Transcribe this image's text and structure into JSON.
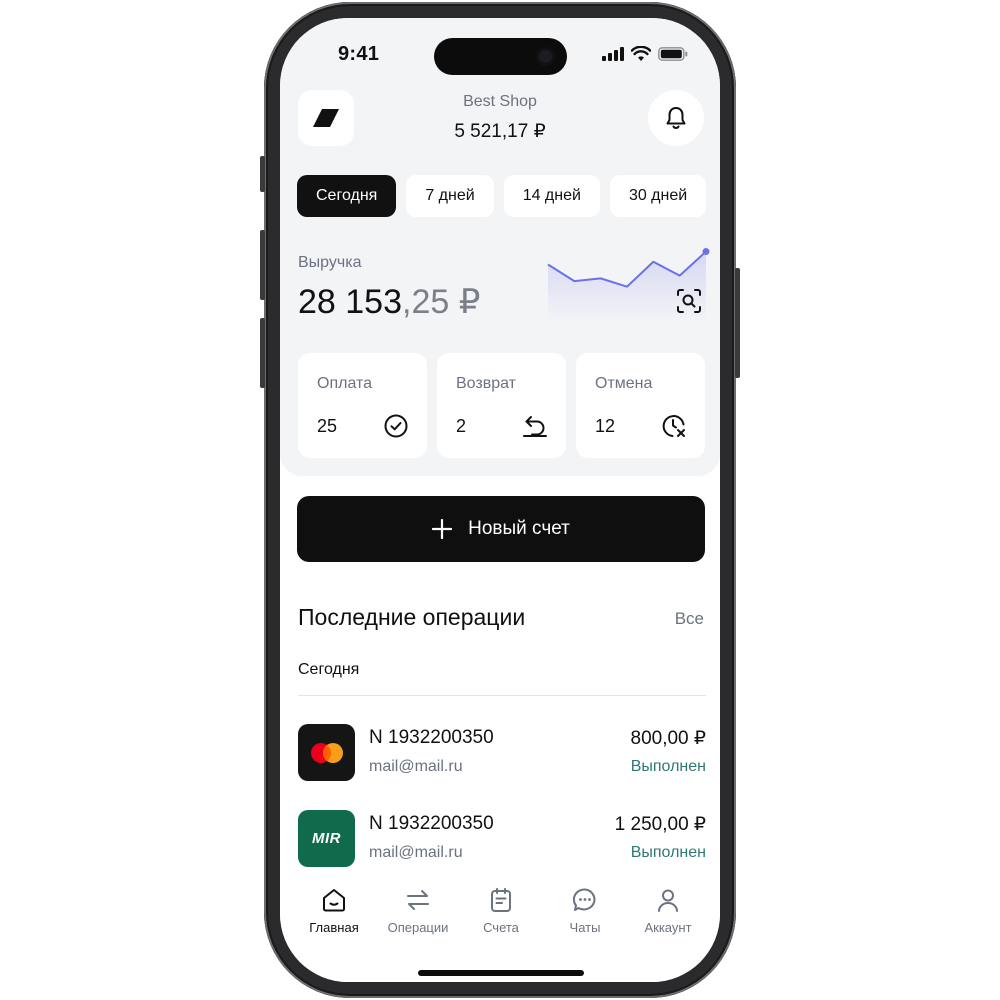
{
  "status_bar": {
    "time": "9:41"
  },
  "header": {
    "shop_name": "Best Shop",
    "balance": "5 521,17 ₽"
  },
  "period_tabs": [
    {
      "label": "Сегодня",
      "active": true
    },
    {
      "label": "7 дней",
      "active": false
    },
    {
      "label": "14 дней",
      "active": false
    },
    {
      "label": "30 дней",
      "active": false
    }
  ],
  "revenue": {
    "label": "Выручка",
    "amount_main": "28 153",
    "amount_fraction": ",25 ₽"
  },
  "revenue_sparkline": {
    "type": "line",
    "values": [
      60,
      42,
      45,
      36,
      63,
      48,
      74
    ],
    "ylim": [
      0,
      80
    ],
    "color": "#6b72e8"
  },
  "stats": [
    {
      "label": "Оплата",
      "value": "25",
      "icon": "check-circle-icon"
    },
    {
      "label": "Возврат",
      "value": "2",
      "icon": "undo-icon"
    },
    {
      "label": "Отмена",
      "value": "12",
      "icon": "clock-cancel-icon"
    }
  ],
  "new_invoice": {
    "label": "Новый счет"
  },
  "recent": {
    "title": "Последние операции",
    "see_all": "Все",
    "group_label": "Сегодня",
    "operations": [
      {
        "number": "N 1932200350",
        "email": "mail@mail.ru",
        "amount": "800,00 ₽",
        "status": "Выполнен",
        "payment_system": "mastercard"
      },
      {
        "number": "N 1932200350",
        "email": "mail@mail.ru",
        "amount": "1 250,00 ₽",
        "status": "Выполнен",
        "payment_system": "mir",
        "logo_text": "MIR"
      }
    ]
  },
  "bottom_nav": [
    {
      "label": "Главная",
      "icon": "home-icon",
      "active": true
    },
    {
      "label": "Операции",
      "icon": "transfer-arrows-icon",
      "active": false
    },
    {
      "label": "Счета",
      "icon": "invoice-icon",
      "active": false
    },
    {
      "label": "Чаты",
      "icon": "chat-icon",
      "active": false
    },
    {
      "label": "Аккаунт",
      "icon": "user-icon",
      "active": false
    }
  ],
  "colors": {
    "accent_dark": "#0f0f10",
    "status_success": "#2e7a72",
    "mir_green": "#0f6b4b",
    "sparkline": "#6b72e8"
  }
}
